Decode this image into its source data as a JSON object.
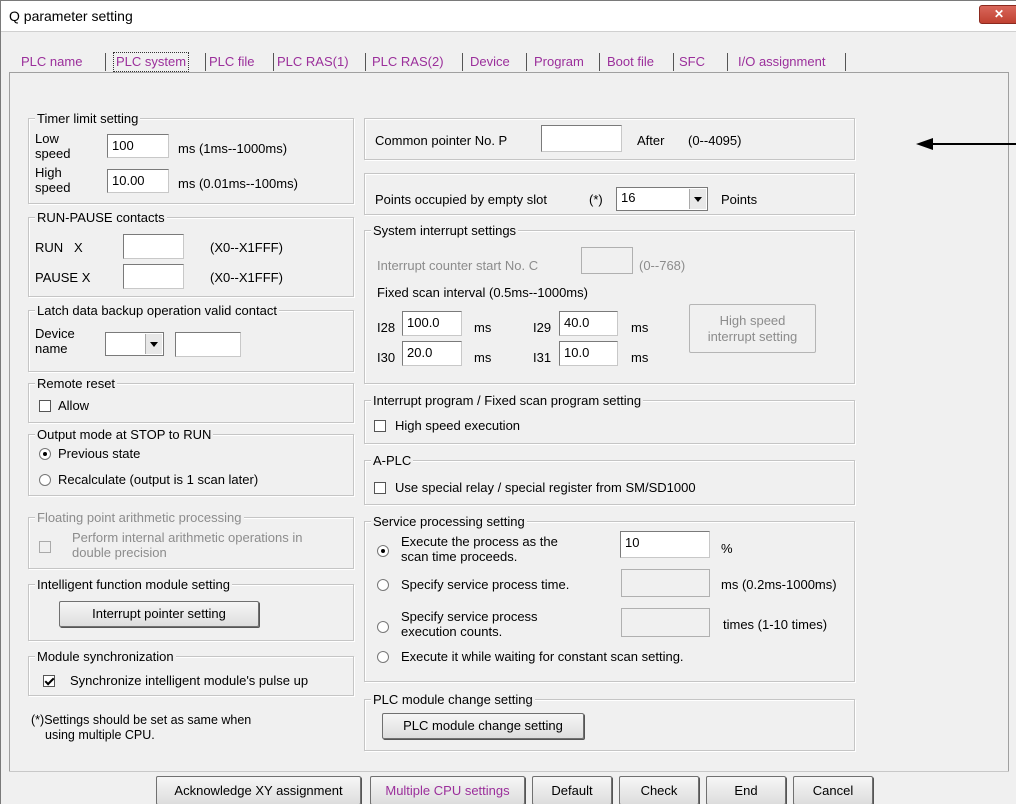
{
  "window": {
    "title": "Q parameter setting",
    "close_label": "✕"
  },
  "tabs": [
    "PLC name",
    "PLC system",
    "PLC file",
    "PLC RAS(1)",
    "PLC RAS(2)",
    "Device",
    "Program",
    "Boot file",
    "SFC",
    "I/O assignment"
  ],
  "active_tab": "PLC system",
  "timer": {
    "title": "Timer limit setting",
    "low_label_1": "Low",
    "low_label_2": "speed",
    "low_value": "100",
    "low_unit": "ms (1ms--1000ms)",
    "high_label_1": "High",
    "high_label_2": "speed",
    "high_value": "10.00",
    "high_unit": "ms (0.01ms--100ms)"
  },
  "run_pause": {
    "title": "RUN-PAUSE contacts",
    "run_label": "RUN   X",
    "run_value": "",
    "run_range": "(X0--X1FFF)",
    "pause_label": "PAUSE X",
    "pause_value": "",
    "pause_range": "(X0--X1FFF)"
  },
  "latch": {
    "title": "Latch data backup operation valid contact",
    "device_label_1": "Device",
    "device_label_2": "name",
    "device_value": "",
    "device_number": ""
  },
  "remote_reset": {
    "title": "Remote reset",
    "allow_label": "Allow",
    "allow_checked": false
  },
  "output_mode": {
    "title": "Output mode at STOP to RUN",
    "previous_label": "Previous state",
    "recalc_label": "Recalculate (output is 1 scan later)",
    "selected": "previous"
  },
  "floating": {
    "title": "Floating point arithmetic processing",
    "opt_line1": "Perform internal arithmetic operations in",
    "opt_line2": "double precision"
  },
  "intelligent": {
    "title": "Intelligent function module setting",
    "button": "Interrupt pointer setting"
  },
  "module_sync": {
    "title": "Module synchronization",
    "label": "Synchronize intelligent module's pulse up",
    "checked": true
  },
  "note": {
    "line1": "(*)Settings should be set as same when",
    "line2": "using multiple CPU."
  },
  "common_pointer": {
    "label": "Common pointer No.  P",
    "value": "",
    "after": "After",
    "range": "(0--4095)"
  },
  "empty_slot": {
    "label": "Points occupied by empty slot",
    "marker": "(*)",
    "value": "16",
    "unit": "Points"
  },
  "system_interrupt": {
    "title": "System interrupt settings",
    "counter_label": "Interrupt counter start No.  C",
    "counter_value": "",
    "counter_range": "(0--768)",
    "fixed_label": "Fixed scan interval  (0.5ms--1000ms)",
    "i28_label": "I28",
    "i28_value": "100.0",
    "i29_label": "I29",
    "i29_value": "40.0",
    "i30_label": "I30",
    "i30_value": "20.0",
    "i31_label": "I31",
    "i31_value": "10.0",
    "unit": "ms",
    "hs_button_1": "High speed",
    "hs_button_2": "interrupt setting"
  },
  "interrupt_program": {
    "title": "Interrupt program / Fixed scan program setting",
    "label": "High speed execution",
    "checked": false
  },
  "aplc": {
    "title": "A-PLC",
    "label": "Use special relay / special register from SM/SD1000",
    "checked": false
  },
  "service": {
    "title": "Service processing setting",
    "opt1_line1": "Execute the process as the",
    "opt1_line2": "scan time proceeds.",
    "opt1_value": "10",
    "opt1_unit": "%",
    "opt2": "Specify service process time.",
    "opt2_value": "",
    "opt2_unit": "ms (0.2ms-1000ms)",
    "opt3_line1": "Specify service process",
    "opt3_line2": "execution counts.",
    "opt3_value": "",
    "opt3_unit": "times (1-10 times)",
    "opt4": "Execute it while waiting for constant scan setting.",
    "selected": 1
  },
  "module_change": {
    "title": "PLC module change setting",
    "button": "PLC module change setting"
  },
  "bottom_buttons": [
    "Acknowledge XY assignment",
    "Multiple CPU settings",
    "Default",
    "Check",
    "End",
    "Cancel"
  ],
  "arrow_annotation": {
    "color": "#000000"
  }
}
